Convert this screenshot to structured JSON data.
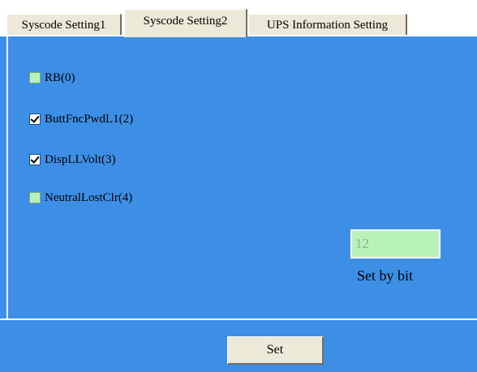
{
  "tabs": [
    {
      "label": "Syscode Setting1",
      "active": false
    },
    {
      "label": "Syscode Setting2",
      "active": true
    },
    {
      "label": "UPS Information Setting",
      "active": false
    }
  ],
  "checkboxes": [
    {
      "label": "RB(0)",
      "checked": false
    },
    {
      "label": "ButtFncPwdL1(2)",
      "checked": true
    },
    {
      "label": "DispLLVolt(3)",
      "checked": true
    },
    {
      "label": "NeutralLostClr(4)",
      "checked": false
    }
  ],
  "bit_field": {
    "value": "12",
    "caption": "Set by bit"
  },
  "set_button": {
    "label": "Set"
  },
  "colors": {
    "background": "#3d8fe6",
    "unchecked_box": "#b9f2b9",
    "tab": "#ece9d8"
  }
}
